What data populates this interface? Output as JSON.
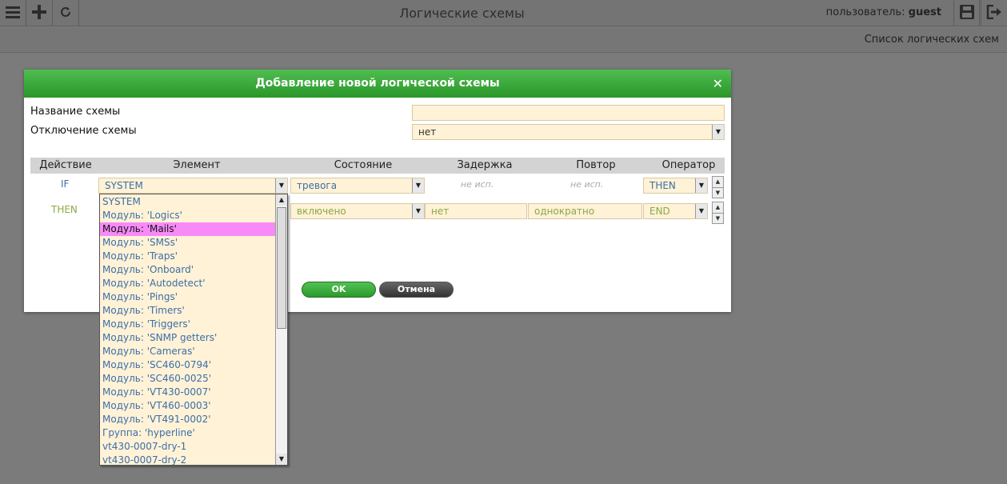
{
  "topbar": {
    "title": "Логические схемы",
    "user_label": "пользователь:",
    "user_name": "guest",
    "icons": [
      "menu-icon",
      "plus-icon",
      "refresh-icon",
      "save-icon",
      "logout-icon"
    ]
  },
  "subbar": {
    "link": "Список логических схем"
  },
  "dialog": {
    "title": "Добавление новой логической схемы",
    "close": "✕",
    "name_label": "Название схемы",
    "name_value": "",
    "disable_label": "Отключение схемы",
    "disable_value": "нет",
    "columns": [
      "Действие",
      "Элемент",
      "Состояние",
      "Задержка",
      "Повтор",
      "Оператор"
    ],
    "rows": [
      {
        "action": "IF",
        "element": "SYSTEM",
        "state": "тревога",
        "delay": "не исп.",
        "repeat": "не исп.",
        "operator": "THEN"
      },
      {
        "action": "THEN",
        "element": "",
        "state": "включено",
        "delay": "нет",
        "repeat": "однократно",
        "operator": "END"
      }
    ],
    "ok": "OK",
    "cancel": "Отмена"
  },
  "dropdown": {
    "selected_index": 2,
    "items": [
      "SYSTEM",
      "Модуль: 'Logics'",
      "Модуль: 'Mails'",
      "Модуль: 'SMSs'",
      "Модуль: 'Traps'",
      "Модуль: 'Onboard'",
      "Модуль: 'Autodetect'",
      "Модуль: 'Pings'",
      "Модуль: 'Timers'",
      "Модуль: 'Triggers'",
      "Модуль: 'SNMP getters'",
      "Модуль: 'Cameras'",
      "Модуль: 'SC460-0794'",
      "Модуль: 'SC460-0025'",
      "Модуль: 'VT430-0007'",
      "Модуль: 'VT460-0003'",
      "Модуль: 'VT491-0002'",
      "Группа: 'hyperline'",
      "vt430-0007-dry-1",
      "vt430-0007-dry-2"
    ]
  },
  "colors": {
    "accent_green": "#2a962a",
    "selected_item": "#f78af7",
    "input_bg": "#fff2d6"
  }
}
